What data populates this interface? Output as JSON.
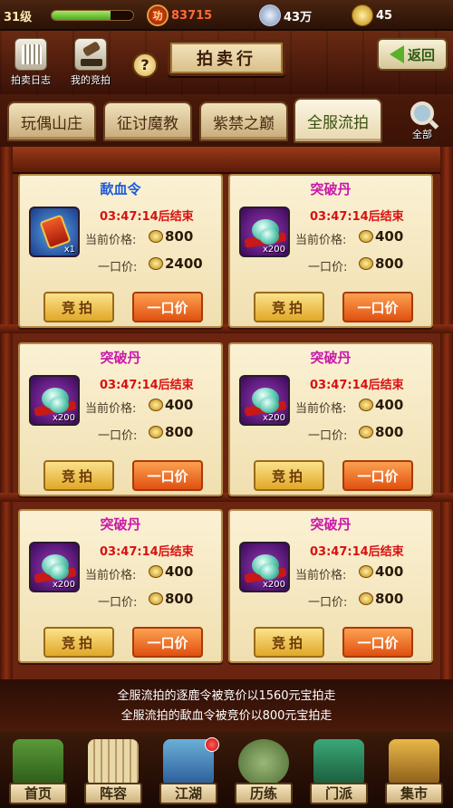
{
  "top_bar": {
    "level": "31级",
    "exp_fraction": 0.72,
    "achievement_icon": "功",
    "achievement_value": "83715",
    "silver_value": "43万",
    "gold_value": "45"
  },
  "header": {
    "auction_log_label": "拍卖日志",
    "my_bids_label": "我的竞拍",
    "help_symbol": "?",
    "title": "拍卖行",
    "back_label": "返回"
  },
  "tabs": [
    {
      "label": "玩偶山庄"
    },
    {
      "label": "征讨魔教"
    },
    {
      "label": "紫禁之巅"
    },
    {
      "label": "全服流拍"
    }
  ],
  "search_label": "全部",
  "listings": [
    {
      "name": "歃血令",
      "name_color": "#1a5ad8",
      "icon": "token-icon",
      "qty": "x1",
      "timer": "03:47:14后结束",
      "current_label": "当前价格:",
      "current_price": "800",
      "buyout_label": "一口价:",
      "buyout_price": "2400",
      "bid_label": "竞拍",
      "buy_label": "一口价"
    },
    {
      "name": "突破丹",
      "name_color": "#c81aa8",
      "icon": "pill-icon",
      "qty": "x200",
      "timer": "03:47:14后结束",
      "current_label": "当前价格:",
      "current_price": "400",
      "buyout_label": "一口价:",
      "buyout_price": "800",
      "bid_label": "竞拍",
      "buy_label": "一口价"
    },
    {
      "name": "突破丹",
      "name_color": "#c81aa8",
      "icon": "pill-icon",
      "qty": "x200",
      "timer": "03:47:14后结束",
      "current_label": "当前价格:",
      "current_price": "400",
      "buyout_label": "一口价:",
      "buyout_price": "800",
      "bid_label": "竞拍",
      "buy_label": "一口价"
    },
    {
      "name": "突破丹",
      "name_color": "#c81aa8",
      "icon": "pill-icon",
      "qty": "x200",
      "timer": "03:47:14后结束",
      "current_label": "当前价格:",
      "current_price": "400",
      "buyout_label": "一口价:",
      "buyout_price": "800",
      "bid_label": "竞拍",
      "buy_label": "一口价"
    },
    {
      "name": "突破丹",
      "name_color": "#c81aa8",
      "icon": "pill-icon",
      "qty": "x200",
      "timer": "03:47:14后结束",
      "current_label": "当前价格:",
      "current_price": "400",
      "buyout_label": "一口价:",
      "buyout_price": "800",
      "bid_label": "竞拍",
      "buy_label": "一口价"
    },
    {
      "name": "突破丹",
      "name_color": "#c81aa8",
      "icon": "pill-icon",
      "qty": "x200",
      "timer": "03:47:14后结束",
      "current_label": "当前价格:",
      "current_price": "400",
      "buyout_label": "一口价:",
      "buyout_price": "800",
      "bid_label": "竞拍",
      "buy_label": "一口价"
    }
  ],
  "broadcast": [
    "全服流拍的逐鹿令被竞价以1560元宝拍走",
    "全服流拍的歃血令被竞价以800元宝拍走"
  ],
  "nav": [
    {
      "label": "首页",
      "icon": "home-icon"
    },
    {
      "label": "阵容",
      "icon": "go-board-icon"
    },
    {
      "label": "江湖",
      "icon": "map-scroll-icon"
    },
    {
      "label": "历练",
      "icon": "jar-icon"
    },
    {
      "label": "门派",
      "icon": "sect-banner-icon"
    },
    {
      "label": "集市",
      "icon": "market-stall-icon"
    }
  ]
}
